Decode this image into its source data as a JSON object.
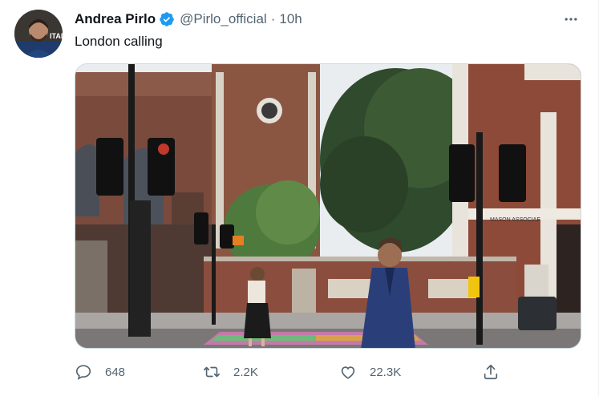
{
  "author": {
    "name": "Andrea Pirlo",
    "handle": "@Pirlo_official",
    "time": "10h",
    "separator": "·",
    "avatar_text": "ITAL"
  },
  "tweet": {
    "text": "London calling"
  },
  "media": {
    "sign_text": "MASON ASSOCIAE",
    "description_icon": "photo"
  },
  "actions": {
    "reply_count": "648",
    "retweet_count": "2.2K",
    "like_count": "22.3K"
  },
  "icons": {
    "verified": "verified-badge-icon",
    "more": "more-icon",
    "reply": "reply-icon",
    "retweet": "retweet-icon",
    "like": "like-icon",
    "share": "share-icon"
  },
  "colors": {
    "accent": "#1d9bf0",
    "text_primary": "#0f1419",
    "text_secondary": "#536471"
  }
}
